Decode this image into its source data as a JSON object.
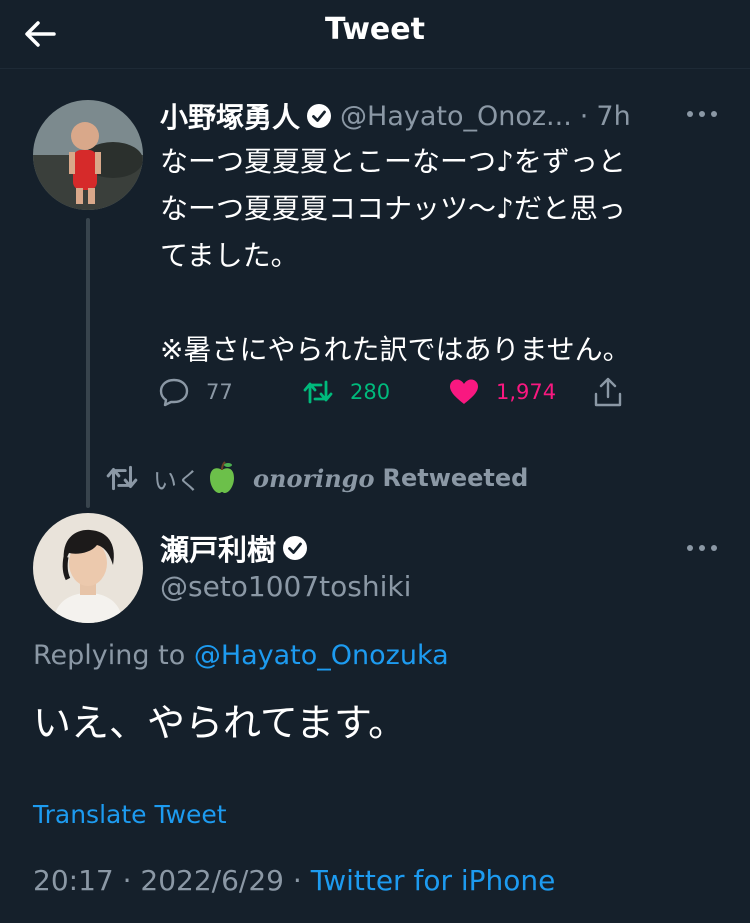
{
  "header": {
    "title": "Tweet",
    "back_icon": "arrow-left-icon"
  },
  "original_tweet": {
    "name": "小野塚勇人",
    "handle": "@Hayato_Onoz...",
    "separator": "·",
    "time": "7h",
    "text_lines": [
      "なーつ夏夏夏とこーなーつ♪をずっと",
      "なーつ夏夏夏ココナッツ〜♪だと思っ",
      "てました。",
      "",
      "※暑さにやられた訳ではありません。"
    ],
    "replies": "77",
    "retweets": "280",
    "likes": "1,974",
    "liked": true,
    "retweeted": true
  },
  "retweet_banner": {
    "user": "いく",
    "user_suffix": "onoringo",
    "label": "Retweeted"
  },
  "reply_tweet": {
    "name": "瀬戸利樹",
    "handle": "@seto1007toshiki",
    "replying_prefix": "Replying to",
    "replying_mention": "@Hayato_Onozuka",
    "text": "いえ、やられてます。",
    "translate": "Translate Tweet",
    "time": "20:17",
    "separator": "·",
    "date": "2022/6/29",
    "client": "Twitter for iPhone"
  },
  "colors": {
    "background": "#15202b",
    "secondary_text": "#8b98a5",
    "link": "#1d9bf0",
    "retweet_green": "#00ba7c",
    "like_pink": "#f91880"
  }
}
